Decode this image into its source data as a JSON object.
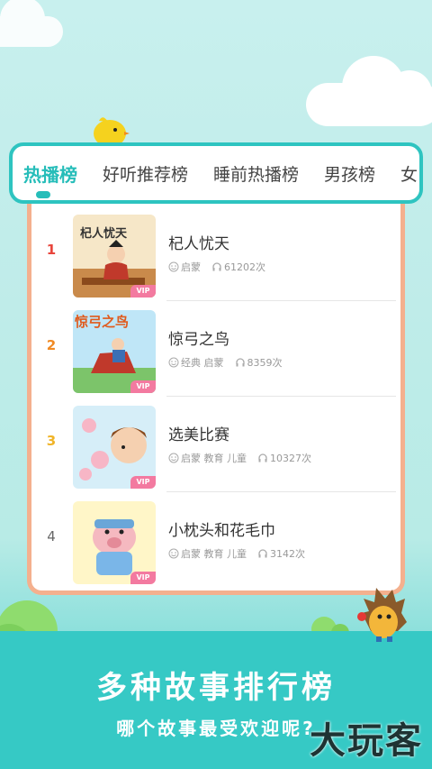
{
  "tabs": [
    {
      "label": "热播榜",
      "active": true
    },
    {
      "label": "好听推荐榜",
      "active": false
    },
    {
      "label": "睡前热播榜",
      "active": false
    },
    {
      "label": "男孩榜",
      "active": false
    },
    {
      "label": "女",
      "active": false
    }
  ],
  "stories": [
    {
      "rank": "1",
      "rank_color": "#e8453c",
      "title": "杞人忧天",
      "tags": "启蒙",
      "plays": "61202次",
      "vip": "VIP",
      "cover_text": "杞人忧天"
    },
    {
      "rank": "2",
      "rank_color": "#f08a24",
      "title": "惊弓之鸟",
      "tags": "经典 启蒙",
      "plays": "8359次",
      "vip": "VIP",
      "cover_text": "惊弓之鸟"
    },
    {
      "rank": "3",
      "rank_color": "#f0b428",
      "title": "选美比赛",
      "tags": "启蒙 教育 儿童",
      "plays": "10327次",
      "vip": "VIP",
      "cover_text": ""
    },
    {
      "rank": "4",
      "rank_color": "#666666",
      "title": "小枕头和花毛巾",
      "tags": "启蒙 教育 儿童",
      "plays": "3142次",
      "vip": "VIP",
      "cover_text": ""
    }
  ],
  "promo": {
    "headline": "多种故事排行榜",
    "subline": "哪个故事最受欢迎呢?"
  },
  "watermark": "大玩客",
  "colors": {
    "accent": "#26bdb9",
    "card_border": "#f4b08e",
    "vip": "#f37aa0"
  }
}
